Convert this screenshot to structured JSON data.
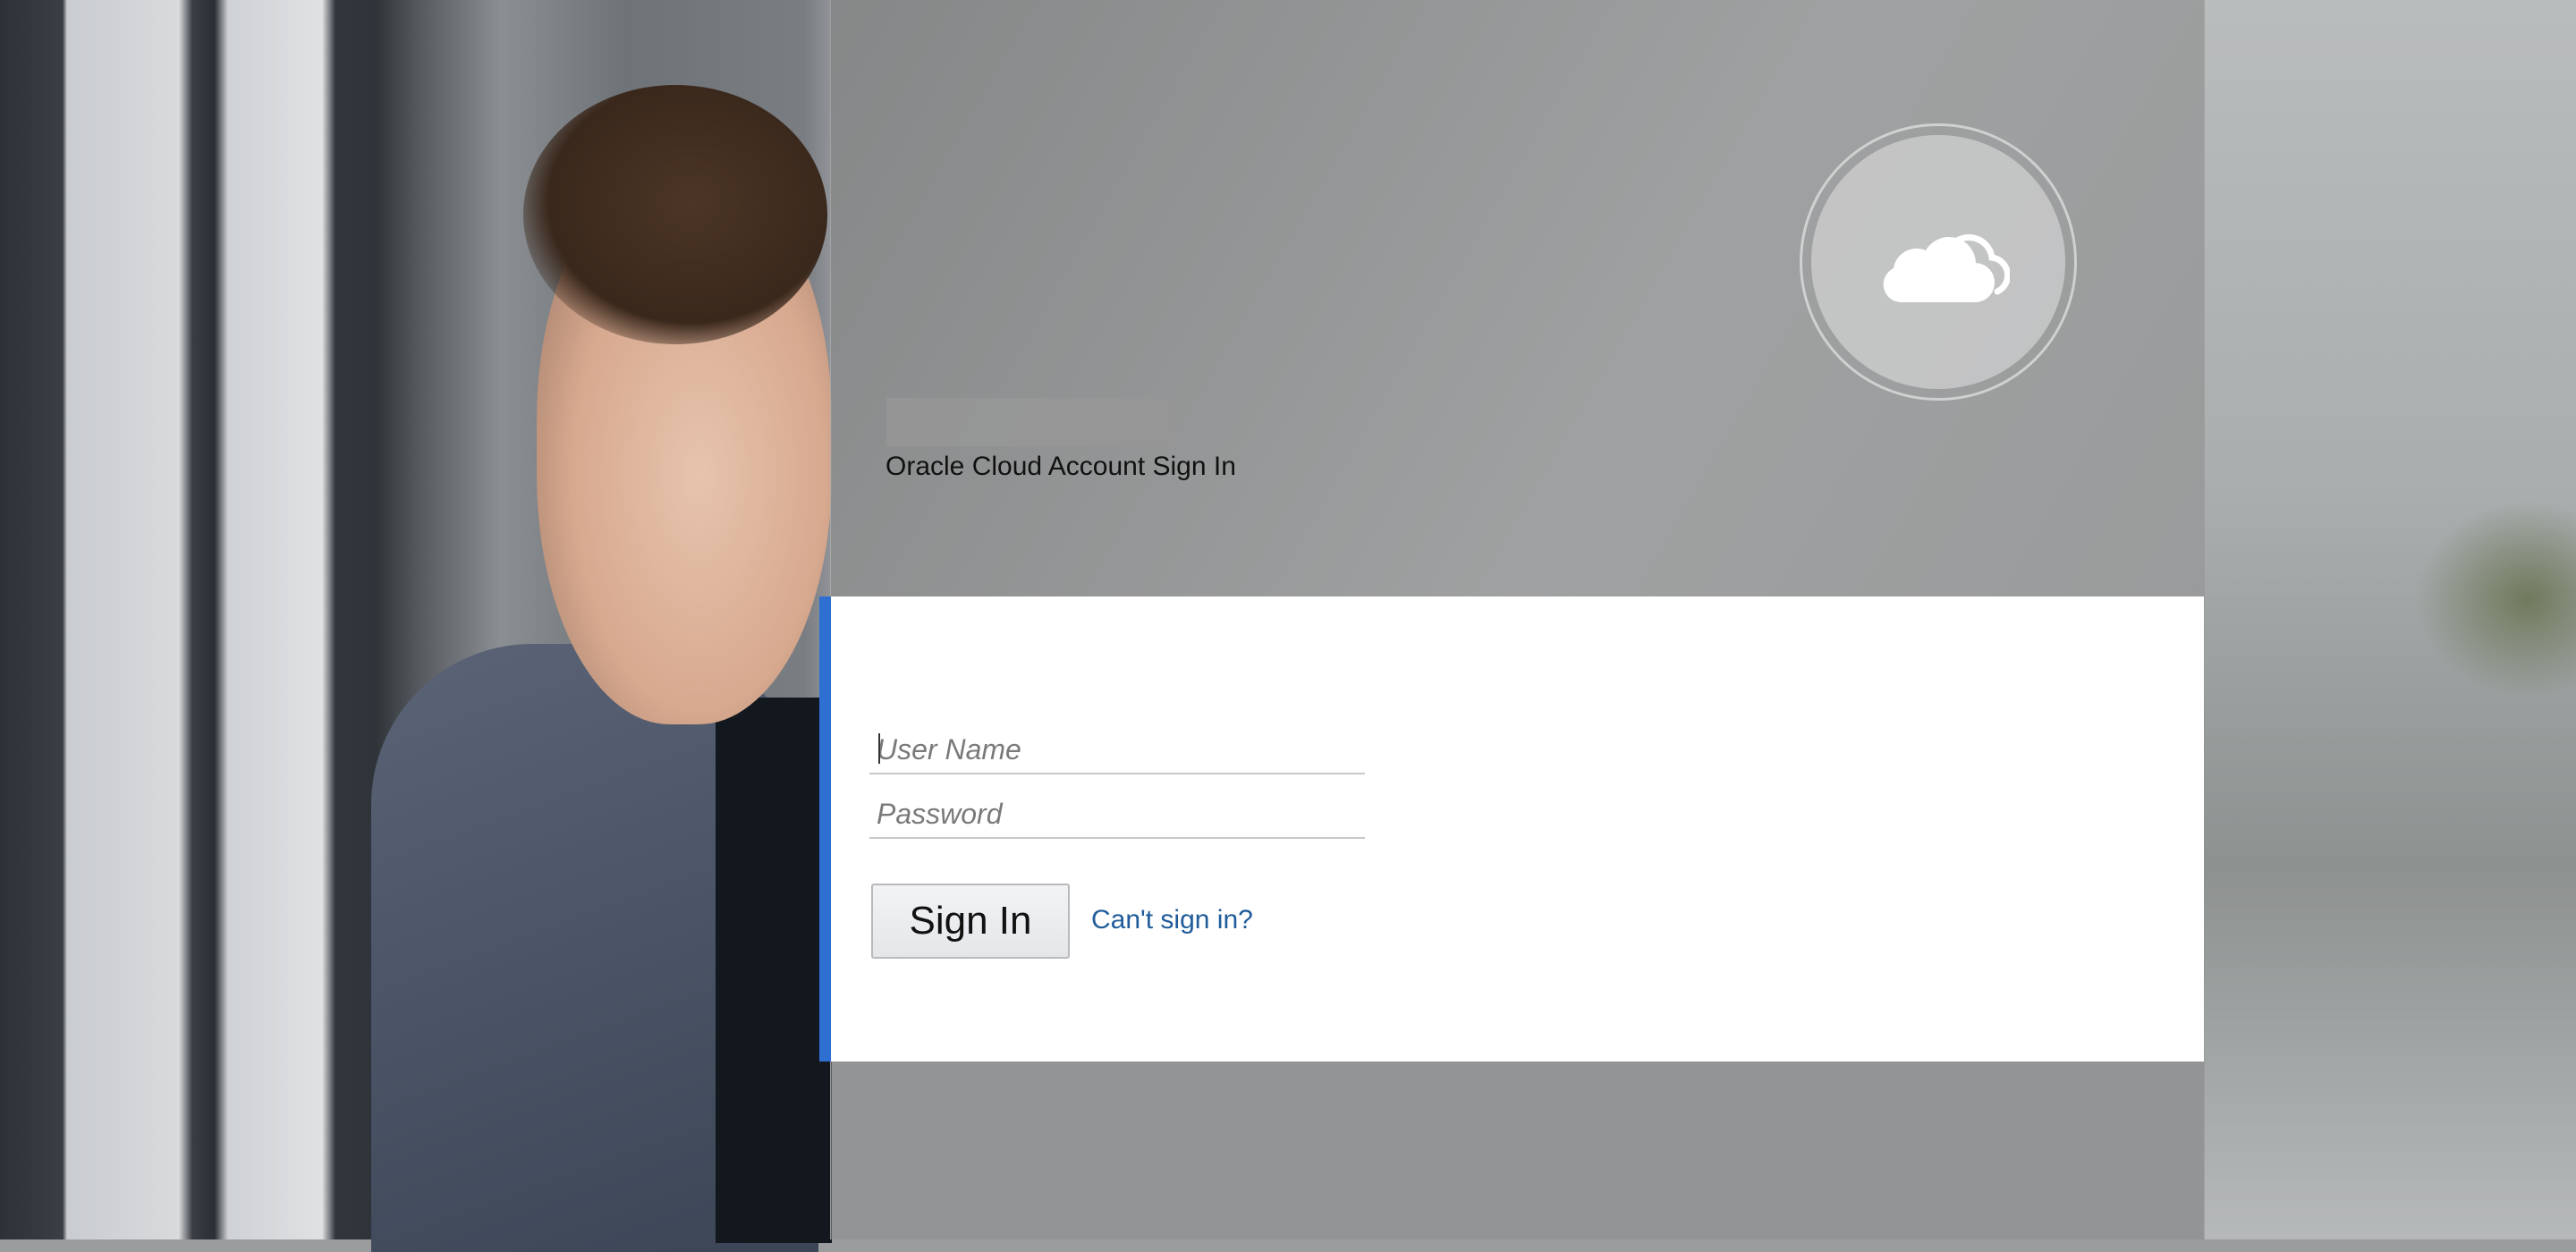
{
  "header": {
    "tenant_name": "",
    "signin_heading": "Oracle Cloud Account Sign In"
  },
  "form": {
    "username_placeholder": "User Name",
    "password_placeholder": "Password",
    "signin_label": "Sign In",
    "cant_signin_label": "Can't sign in?"
  },
  "icons": {
    "logo": "cloud-icon"
  },
  "colors": {
    "accent": "#2f6fd1",
    "link": "#1f5c99",
    "card": "#ffffff"
  }
}
